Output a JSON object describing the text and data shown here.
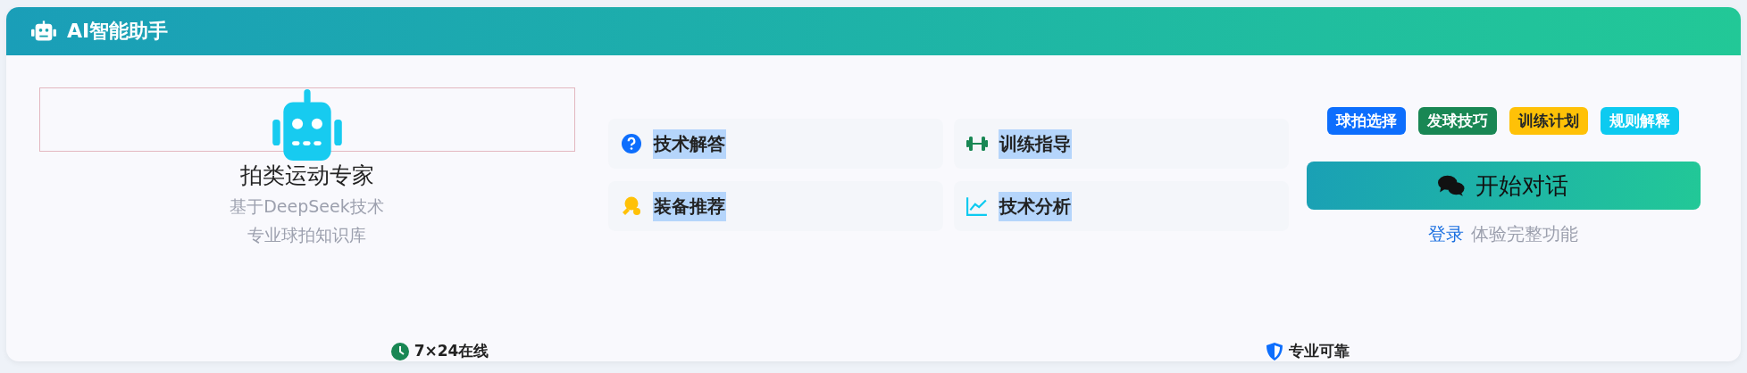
{
  "header": {
    "title": "AI智能助手"
  },
  "profile": {
    "title": "拍类运动专家",
    "lines": [
      "基于DeepSeek技术",
      "专业球拍知识库"
    ]
  },
  "features": [
    {
      "kind": "question",
      "label": "技术解答"
    },
    {
      "kind": "dumbbell",
      "label": "训练指导"
    },
    {
      "kind": "paddle",
      "label": "装备推荐"
    },
    {
      "kind": "chart",
      "label": "技术分析"
    }
  ],
  "tags": [
    {
      "label": "球拍选择",
      "color": "#0d6efd"
    },
    {
      "label": "发球技巧",
      "color": "#198754"
    },
    {
      "label": "训练计划",
      "color": "#ffc107"
    },
    {
      "label": "规则解释",
      "color": "#0dcaf0"
    }
  ],
  "start_button": {
    "label": "开始对话"
  },
  "login": {
    "link": "登录",
    "text": "体验完整功能"
  },
  "footer": [
    {
      "kind": "clock",
      "label": "7×24在线"
    },
    {
      "kind": "shield",
      "label": "专业可靠"
    }
  ]
}
